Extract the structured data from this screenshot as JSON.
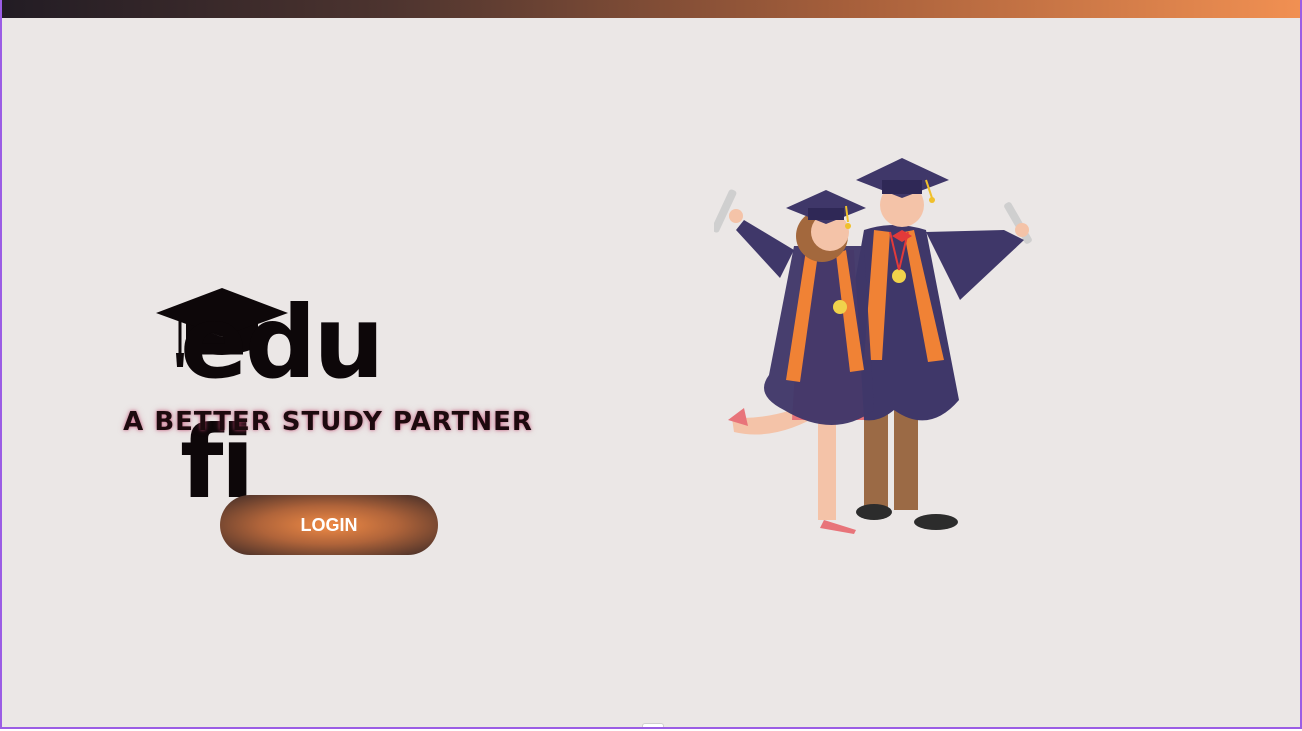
{
  "brand": {
    "logo_text": "edu fi",
    "tagline": "A BETTER STUDY PARTNER"
  },
  "actions": {
    "login_label": "LOGIN"
  },
  "illustration": {
    "icon": "graduates-illustration",
    "cap_icon": "graduation-cap-icon"
  },
  "colors": {
    "accent_orange": "#f19052",
    "dark_brown": "#3d2a27",
    "background": "#ebe7e6",
    "gown_navy": "#3f3769",
    "stole_orange": "#f08235"
  }
}
